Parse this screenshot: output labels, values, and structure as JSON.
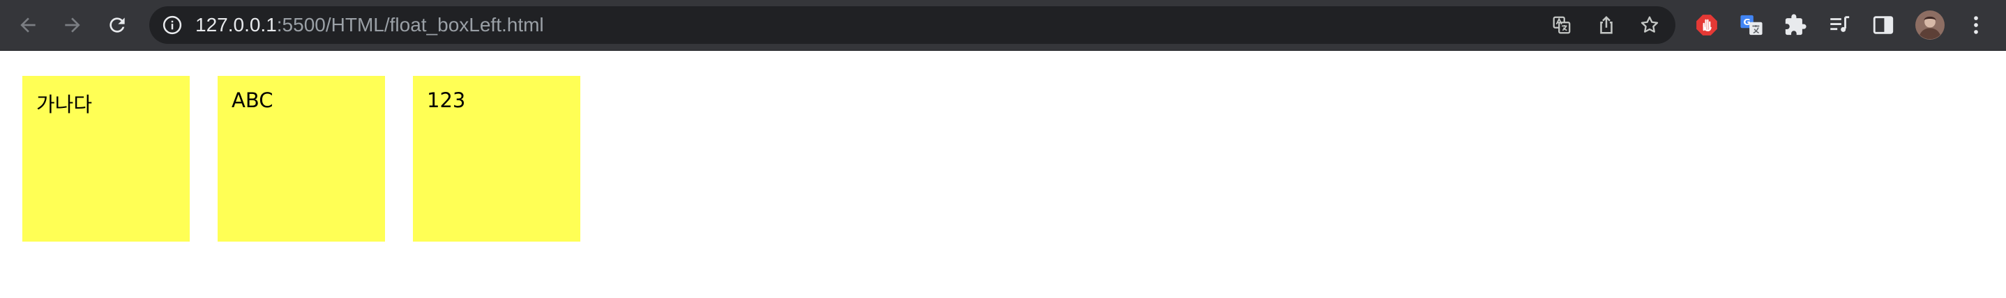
{
  "browser": {
    "url_host": "127.0.0.1",
    "url_rest": ":5500/HTML/float_boxLeft.html"
  },
  "page": {
    "boxes": [
      {
        "text": "가나다"
      },
      {
        "text": "ABC"
      },
      {
        "text": "123"
      }
    ]
  },
  "colors": {
    "box_fill": "#ffff55",
    "toolbar": "#35363a",
    "omnibox": "#202124"
  },
  "icons": [
    "back-icon",
    "forward-icon",
    "reload-icon",
    "info-icon",
    "translate-icon",
    "share-icon",
    "bookmark-star-icon",
    "adblock-hand-icon",
    "google-translate-icon",
    "puzzle-extensions-icon",
    "reading-list-icon",
    "side-panel-icon",
    "profile-avatar",
    "more-menu-icon"
  ]
}
